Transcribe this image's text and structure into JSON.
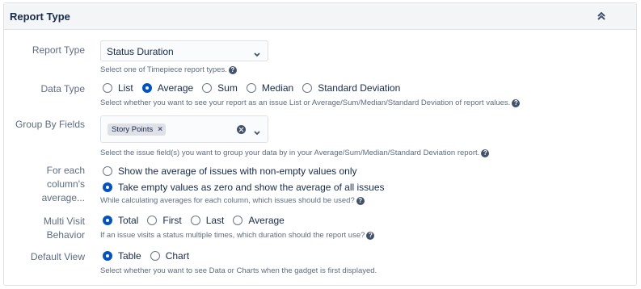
{
  "panel": {
    "title": "Report Type",
    "collapse_icon": "double-chevron-up-icon"
  },
  "report_type": {
    "label": "Report Type",
    "value": "Status Duration",
    "help": "Select one of Timepiece report types."
  },
  "data_type": {
    "label": "Data Type",
    "options": [
      "List",
      "Average",
      "Sum",
      "Median",
      "Standard Deviation"
    ],
    "selected": "Average",
    "help": "Select whether you want to see your report as an issue List or Average/Sum/Median/Standard Deviation of report values."
  },
  "group_by": {
    "label": "Group By Fields",
    "tags": [
      "Story Points"
    ],
    "help": "Select the issue field(s) you want to group your data by in your Average/Sum/Median/Standard Deviation report."
  },
  "for_each_column": {
    "label_lines": [
      "For each",
      "column's",
      "average..."
    ],
    "options": [
      "Show the average of issues with non-empty values only",
      "Take empty values as zero and show the average of all issues"
    ],
    "selected": "Take empty values as zero and show the average of all issues",
    "help": "While calculating averages for each column, which issues should be used?"
  },
  "multi_visit": {
    "label_lines": [
      "Multi Visit",
      "Behavior"
    ],
    "options": [
      "Total",
      "First",
      "Last",
      "Average"
    ],
    "selected": "Total",
    "help": "If an issue visits a status multiple times, which duration should the report use?"
  },
  "default_view": {
    "label": "Default View",
    "options": [
      "Table",
      "Chart"
    ],
    "selected": "Table",
    "help": "Select whether you want to see Data or Charts when the gadget is first displayed."
  },
  "colors": {
    "accent": "#0052cc",
    "text": "#172b4d",
    "muted": "#5e6c84",
    "border": "#dfe1e6"
  },
  "help_icon_glyph": "?"
}
